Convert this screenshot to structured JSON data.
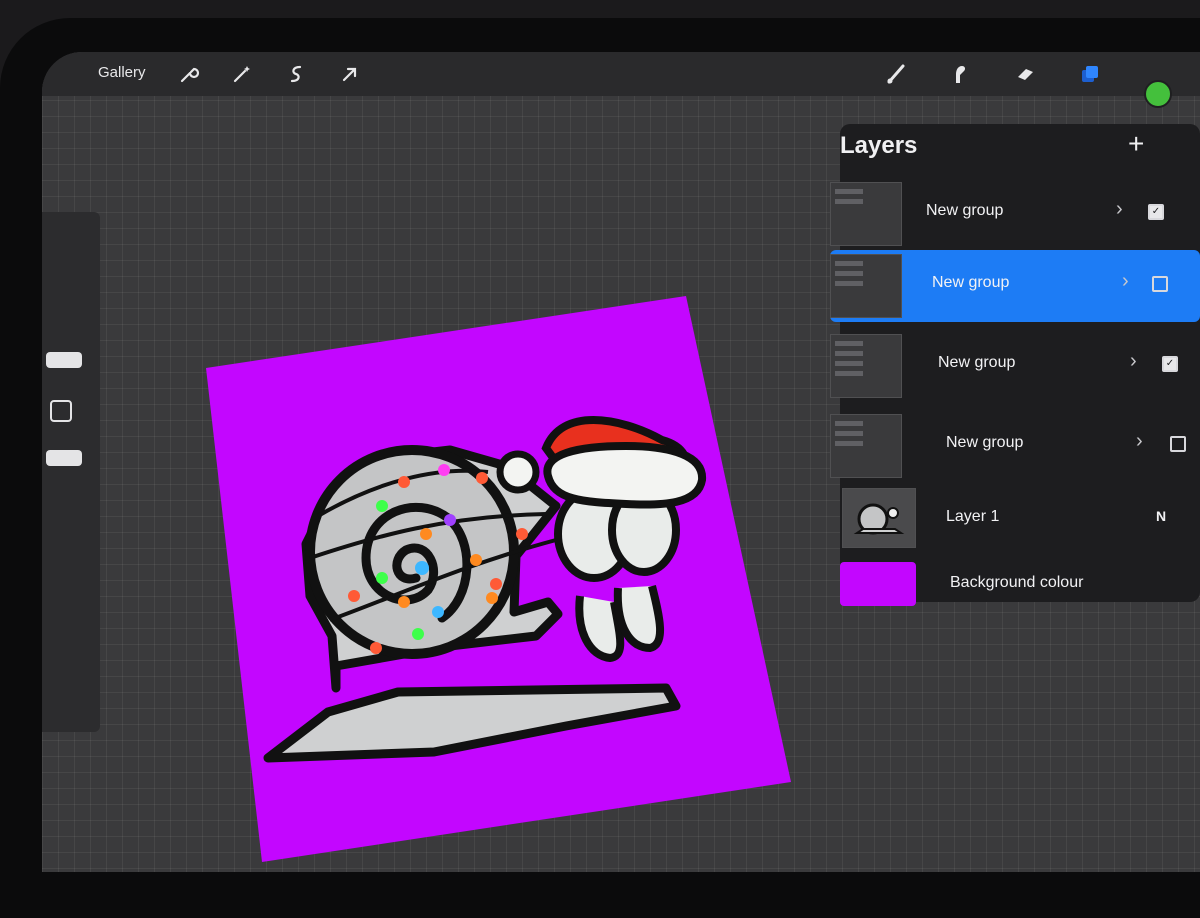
{
  "toolbar": {
    "gallery_label": "Gallery",
    "left_tools": [
      "wrench-icon",
      "magic-wand-icon",
      "selection-icon",
      "transform-arrow-icon"
    ],
    "right_tools": [
      "brush-icon",
      "smudge-icon",
      "eraser-icon",
      "layers-icon"
    ],
    "current_color": "#44c03c"
  },
  "layers_panel": {
    "title": "Layers",
    "add_label": "+",
    "layers": [
      {
        "name": "New group",
        "visible": true,
        "selected": false,
        "expandable": true
      },
      {
        "name": "New group",
        "visible": false,
        "selected": true,
        "expandable": true
      },
      {
        "name": "New group",
        "visible": true,
        "selected": false,
        "expandable": true
      },
      {
        "name": "New group",
        "visible": false,
        "selected": false,
        "expandable": true
      },
      {
        "name": "Layer 1",
        "blend_mode": "N",
        "visible": true,
        "selected": false
      }
    ],
    "background": {
      "label": "Background colour",
      "color": "#c306ff"
    }
  },
  "canvas": {
    "background_color": "#c306ff"
  },
  "accent": "#1d7cf5"
}
